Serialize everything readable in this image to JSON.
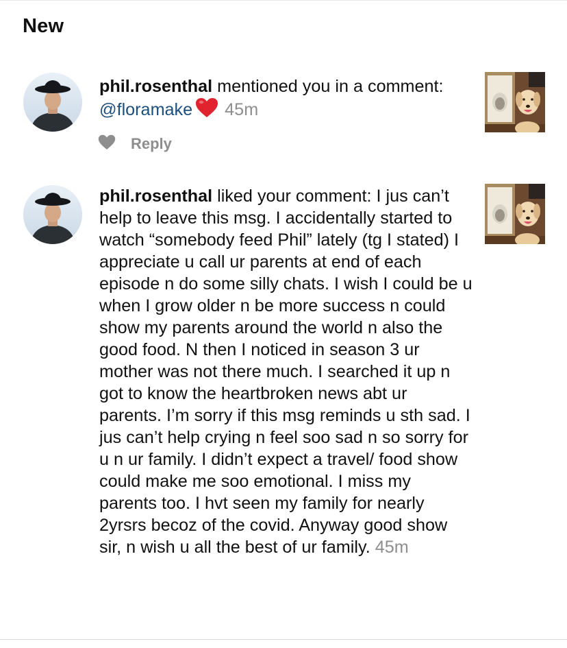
{
  "section": {
    "title": "New"
  },
  "notifications": [
    {
      "username": "phil.rosenthal",
      "action": " mentioned you in a comment: ",
      "mention": "@floramake",
      "emoji": "heart-emoji",
      "time": "45m",
      "reply_label": "Reply"
    },
    {
      "username": "phil.rosenthal",
      "action": " liked your comment: I jus can’t help to leave this msg. I accidentally started to watch “somebody feed Phil” lately (tg I stated) I appreciate u call ur parents at end of each episode n do some silly chats. I wish I could be u when I grow older n be more success n could show my parents around the world n also the good food. N then I noticed in season 3 ur mother was not there much. I searched it up n got to know the heartbroken news abt ur parents. I’m sorry if this msg reminds u sth sad. I jus can’t help crying n feel soo sad n so sorry for u n ur family. I didn’t expect a travel/ food show could make me soo emotional. I miss my parents too. I hvt seen my family for nearly 2yrsrs becoz of the covid. Anyway good show sir, n wish u all the best of ur family. ",
      "time": "45m"
    }
  ],
  "colors": {
    "mention": "#1d4f7c",
    "timestamp": "#8e8e8e",
    "heart_emoji": "#e0232e"
  }
}
